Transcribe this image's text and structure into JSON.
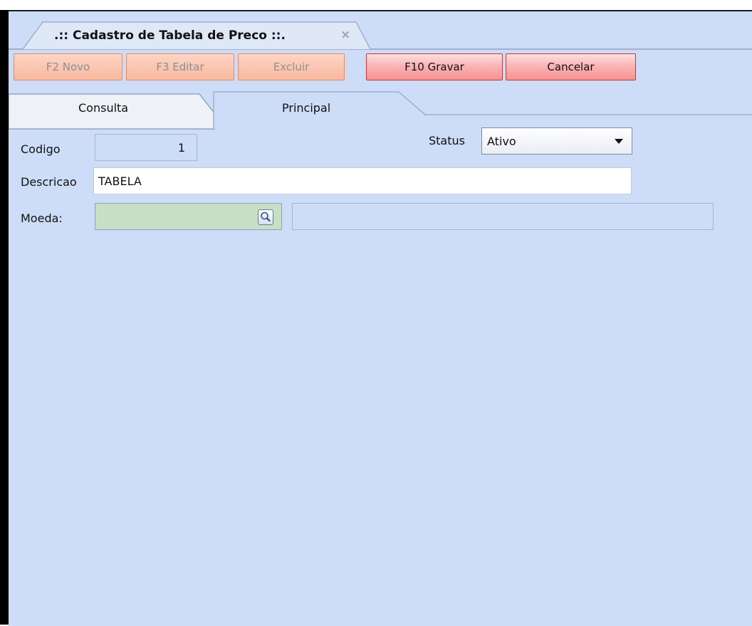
{
  "window": {
    "tab_title": ".:: Cadastro de Tabela de Preco ::.",
    "close_glyph": "×"
  },
  "toolbar": {
    "new_label": "F2 Novo",
    "edit_label": "F3 Editar",
    "delete_label": "Excluir",
    "save_label": "F10 Gravar",
    "cancel_label": "Cancelar"
  },
  "tabs": [
    {
      "label": "Consulta",
      "selected": false
    },
    {
      "label": "Principal",
      "selected": true
    }
  ],
  "form": {
    "codigo_label": "Codigo",
    "codigo_value": "1",
    "status_label": "Status",
    "status_value": "Ativo",
    "descricao_label": "Descricao",
    "descricao_value": "TABELA",
    "moeda_label": "Moeda:",
    "moeda_value": "",
    "moeda_description": ""
  },
  "icons": {
    "lookup": "magnifier-icon",
    "dropdown": "chevron-down-icon",
    "close": "close-icon"
  },
  "colors": {
    "panel_bg": "#cddcf7",
    "disabled_button": "#f7b89f",
    "active_button": "#f49393",
    "moeda_field_bg": "#c5e0c5"
  }
}
